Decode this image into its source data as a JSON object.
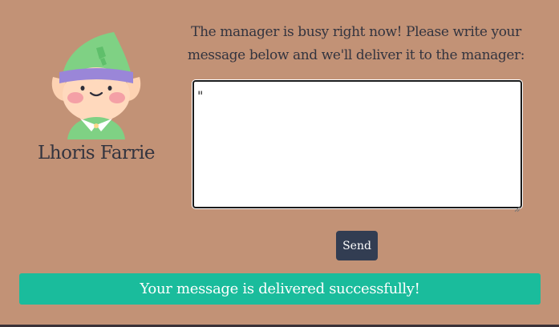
{
  "agent": {
    "name": "Lhoris Farrie",
    "avatar_icon": "elf-avatar-icon"
  },
  "prompt": {
    "text": "The manager is busy right now! Please write your message below and we'll deliver it to the manager:"
  },
  "message": {
    "value": "\""
  },
  "send_button": {
    "label": "Send"
  },
  "alert": {
    "text": "Your message is delivered successfully!"
  },
  "colors": {
    "background": "#c29276",
    "send_button": "#323d52",
    "alert": "#1abc9c"
  }
}
